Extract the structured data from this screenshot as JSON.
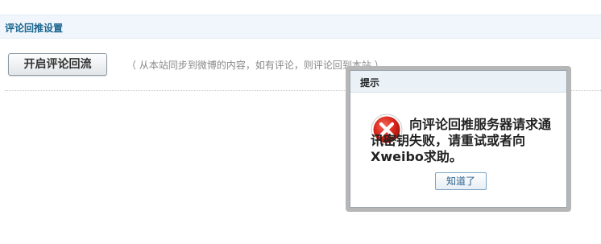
{
  "section": {
    "title": "评论回推设置"
  },
  "main": {
    "button_label": "开启评论回流",
    "hint": "（ 从本站同步到微博的内容，如有评论，则评论回到本站 ）"
  },
  "dialog": {
    "title": "提示",
    "message": "向评论回推服务器请求通讯密钥失败，请重试或者向Xweibo求助。",
    "ok_label": "知道了",
    "icon": "error-icon"
  },
  "colors": {
    "header_bg": "#f0f6fb",
    "title_color": "#19658f",
    "error_red": "#d9261c"
  }
}
